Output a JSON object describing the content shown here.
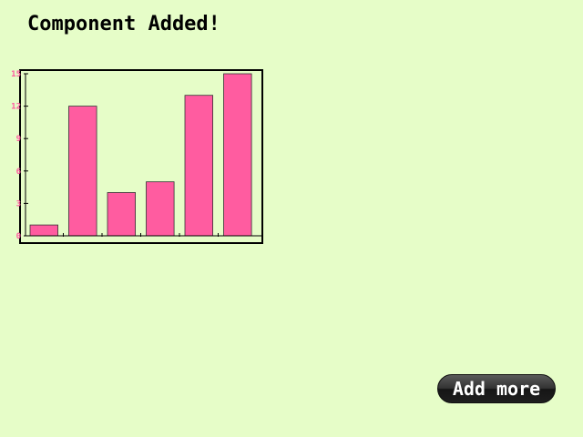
{
  "page": {
    "title": "Component Added!",
    "background_color": "#e6fdc8"
  },
  "chart_data": {
    "type": "bar",
    "categories": [
      "",
      "",
      "",
      "",
      "",
      ""
    ],
    "values": [
      1,
      12,
      4,
      5,
      13,
      15
    ],
    "title": "",
    "xlabel": "",
    "ylabel": "",
    "ylim": [
      0,
      15
    ],
    "y_ticks": [
      "0",
      "3",
      "6",
      "9",
      "12",
      "15"
    ],
    "grid": false,
    "bar_color": "#ff5ca0",
    "tick_label_color": "#ff5ca0"
  },
  "actions": {
    "add_more_label": "Add more"
  }
}
